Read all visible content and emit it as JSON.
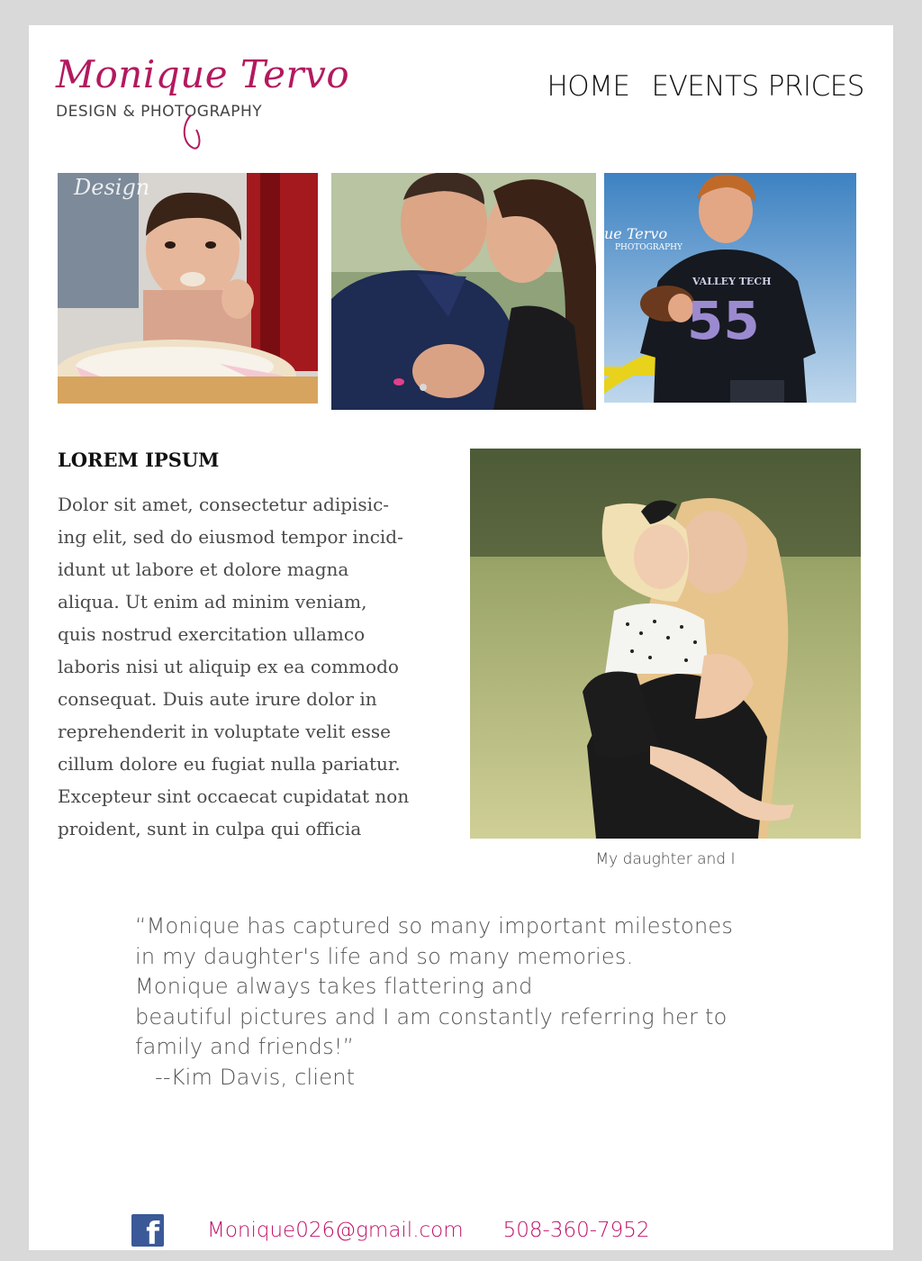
{
  "brand": {
    "name": "Monique Tervo",
    "tagline_left": "DESIGN",
    "tagline_amp": "&",
    "tagline_right": "PHOTOGRAPHY",
    "color": "#b3195f"
  },
  "nav": {
    "items": [
      {
        "label": "HOME"
      },
      {
        "label": "EVENTS"
      },
      {
        "label": "PRICES"
      }
    ]
  },
  "gallery": {
    "thumbs": [
      {
        "subject": "baby eating birthday cake",
        "watermark": "Design"
      },
      {
        "subject": "couple dancing close together",
        "watermark": ""
      },
      {
        "subject": "football player holding ball, jersey 55",
        "watermark": "ue Tervo",
        "watermark_sub": "PHOTOGRAPHY",
        "jersey_number": "55",
        "jersey_text": "VALLEY TECH"
      }
    ]
  },
  "article": {
    "title": "LOREM IPSUM",
    "body": "Dolor sit amet, consectetur adipisic-ing elit, sed do eiusmod tempor incid-idunt ut labore et dolore magna aliqua. Ut enim ad minim veniam, quis nostrud exercitation ullamco laboris nisi ut aliquip ex ea commodo consequat. Duis aute irure dolor in reprehenderit in voluptate velit esse cillum dolore eu fugiat nulla pariatur. Excepteur sint occaecat cupidatat non proident, sunt in culpa qui officia",
    "lines": [
      "Dolor sit amet, consectetur adipisic-",
      "ing elit, sed do eiusmod tempor incid-",
      "idunt ut labore et dolore magna",
      "aliqua. Ut enim ad minim veniam,",
      "quis nostrud exercitation ullamco",
      "laboris nisi ut aliquip ex ea commodo",
      "consequat. Duis aute irure dolor in",
      "reprehenderit in voluptate velit esse",
      "cillum dolore eu fugiat nulla pariatur.",
      "Excepteur sint occaecat cupidatat non",
      "proident, sunt in culpa qui officia"
    ]
  },
  "feature": {
    "subject": "mother holding daughter in a field",
    "caption": "My daughter and I"
  },
  "testimonial": {
    "lines": [
      "“Monique has captured so many important milestones",
      "in my daughter's life and so many memories.",
      "Monique always takes flattering and",
      "beautiful pictures and I am constantly referring her to",
      "family and friends!”"
    ],
    "attribution": "--Kim Davis, client"
  },
  "footer": {
    "facebook_icon": "facebook-icon",
    "facebook_glyph": "f",
    "email": "Monique026@gmail.com",
    "phone": "508-360-7952",
    "accent_color": "#c0136b"
  }
}
